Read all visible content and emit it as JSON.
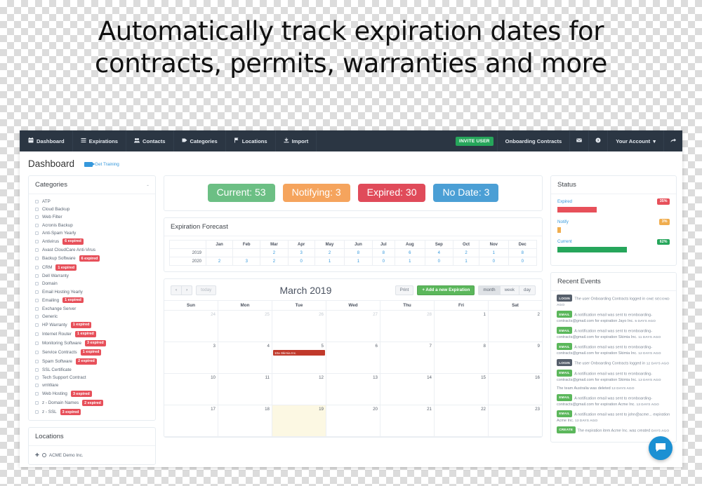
{
  "headline": "Automatically track expiration dates for contracts, permits, warranties and more",
  "navbar": {
    "left_items": [
      {
        "label": "Dashboard",
        "icon": "calendar-icon"
      },
      {
        "label": "Expirations",
        "icon": "list-icon"
      },
      {
        "label": "Contacts",
        "icon": "contacts-icon"
      },
      {
        "label": "Categories",
        "icon": "tag-icon"
      },
      {
        "label": "Locations",
        "icon": "flag-icon"
      },
      {
        "label": "Import",
        "icon": "import-icon"
      }
    ],
    "invite_label": "INVITE USER",
    "account_name": "Onboarding Contracts",
    "mail_icon": "envelope-icon",
    "help_icon": "question-circle-icon",
    "your_account": "Your Account",
    "logout_icon": "logout-icon"
  },
  "page": {
    "title": "Dashboard",
    "get_training": "Get Training"
  },
  "categories": {
    "title": "Categories",
    "collapse": "-",
    "items": [
      {
        "label": "ATP",
        "badge": ""
      },
      {
        "label": "Cloud Backup",
        "badge": ""
      },
      {
        "label": "Web Filter",
        "badge": ""
      },
      {
        "label": "Acronis Backup",
        "badge": ""
      },
      {
        "label": "Anti-Spam Yearly",
        "badge": ""
      },
      {
        "label": "Antivirus",
        "badge": "6 expired"
      },
      {
        "label": "Avast CloudCare Anti-Virus",
        "badge": ""
      },
      {
        "label": "Backup Software",
        "badge": "6 expired"
      },
      {
        "label": "CRM",
        "badge": "1 expired"
      },
      {
        "label": "Dell Warranty",
        "badge": ""
      },
      {
        "label": "Domain",
        "badge": ""
      },
      {
        "label": "Email Hosting Yearly",
        "badge": ""
      },
      {
        "label": "Emailing",
        "badge": "1 expired"
      },
      {
        "label": "Exchange Server",
        "badge": ""
      },
      {
        "label": "Generic",
        "badge": ""
      },
      {
        "label": "HP Warranty",
        "badge": "1 expired"
      },
      {
        "label": "Internet Router",
        "badge": "1 expired"
      },
      {
        "label": "Monitoring Software",
        "badge": "3 expired"
      },
      {
        "label": "Service Contracts",
        "badge": "1 expired"
      },
      {
        "label": "Spam Software",
        "badge": "2 expired"
      },
      {
        "label": "SSL Certificate",
        "badge": ""
      },
      {
        "label": "Tech Support Contract",
        "badge": ""
      },
      {
        "label": "vmWare",
        "badge": ""
      },
      {
        "label": "Web Hosting",
        "badge": "3 expired"
      },
      {
        "label": "z - Domain Names",
        "badge": "2 expired"
      },
      {
        "label": "z - SSL",
        "badge": "3 expired"
      }
    ]
  },
  "locations": {
    "title": "Locations",
    "items": [
      {
        "label": "ACME Demo Inc."
      }
    ]
  },
  "tiles": [
    {
      "label": "Current: 53",
      "color": "#6cbf84"
    },
    {
      "label": "Notifying: 3",
      "color": "#f5a45d"
    },
    {
      "label": "Expired: 30",
      "color": "#e04b5a"
    },
    {
      "label": "No Date: 3",
      "color": "#4b9fd5"
    }
  ],
  "forecast": {
    "title": "Expiration Forecast",
    "months": [
      "Jan",
      "Feb",
      "Mar",
      "Apr",
      "May",
      "Jun",
      "Jul",
      "Aug",
      "Sep",
      "Oct",
      "Nov",
      "Dec"
    ],
    "rows": [
      {
        "year": "2019",
        "values": [
          "",
          "",
          "2",
          "3",
          "2",
          "8",
          "8",
          "6",
          "4",
          "2",
          "1",
          "8"
        ]
      },
      {
        "year": "2020",
        "values": [
          "2",
          "3",
          "2",
          "0",
          "1",
          "1",
          "0",
          "1",
          "0",
          "1",
          "0",
          "0"
        ]
      }
    ]
  },
  "calendar": {
    "prev": "‹",
    "next": "›",
    "today_label": "today",
    "title": "March 2019",
    "print_label": "Print",
    "add_label": "+ Add a new Expiration",
    "views": [
      "month",
      "week",
      "day"
    ],
    "active_view": "month",
    "weekdays": [
      "Sun",
      "Mon",
      "Tue",
      "Wed",
      "Thu",
      "Fri",
      "Sat"
    ],
    "weeks": [
      [
        {
          "num": "24",
          "other": true
        },
        {
          "num": "25",
          "other": true
        },
        {
          "num": "26",
          "other": true
        },
        {
          "num": "27",
          "other": true
        },
        {
          "num": "28",
          "other": true
        },
        {
          "num": "1",
          "other": false
        },
        {
          "num": "2",
          "other": false
        }
      ],
      [
        {
          "num": "3",
          "other": false
        },
        {
          "num": "4",
          "other": false
        },
        {
          "num": "5",
          "other": false,
          "event": "10a Skimia Inc."
        },
        {
          "num": "6",
          "other": false
        },
        {
          "num": "7",
          "other": false
        },
        {
          "num": "8",
          "other": false
        },
        {
          "num": "9",
          "other": false
        }
      ],
      [
        {
          "num": "10",
          "other": false
        },
        {
          "num": "11",
          "other": false
        },
        {
          "num": "12",
          "other": false
        },
        {
          "num": "13",
          "other": false
        },
        {
          "num": "14",
          "other": false
        },
        {
          "num": "15",
          "other": false
        },
        {
          "num": "16",
          "other": false
        }
      ],
      [
        {
          "num": "17",
          "other": false
        },
        {
          "num": "18",
          "other": false
        },
        {
          "num": "19",
          "other": false,
          "today": true
        },
        {
          "num": "20",
          "other": false
        },
        {
          "num": "21",
          "other": false
        },
        {
          "num": "22",
          "other": false
        },
        {
          "num": "23",
          "other": false
        }
      ]
    ]
  },
  "status": {
    "title": "Status",
    "bars": [
      {
        "label": "Expired",
        "pct": "35%",
        "width": 35,
        "color": "#e7505a"
      },
      {
        "label": "Notify",
        "pct": "3%",
        "width": 3,
        "color": "#f0ad4e"
      },
      {
        "label": "Current",
        "pct": "62%",
        "width": 62,
        "color": "#26a65b"
      }
    ]
  },
  "recent_events": {
    "title": "Recent Events",
    "items": [
      {
        "tag": "LOGIN",
        "tag_class": "login",
        "text": "The user Onboarding Contracts logged in",
        "time": "ONE SECOND AGO"
      },
      {
        "tag": "EMAIL",
        "tag_class": "email",
        "text": "A notification email was sent to eronboarding-contracts@gmail.com for expiration Jayo Inc.",
        "time": "5 DAYS AGO"
      },
      {
        "tag": "EMAIL",
        "tag_class": "email",
        "text": "A notification email was sent to eronboarding-contracts@gmail.com for expiration Skimia Inc.",
        "time": "11 DAYS AGO"
      },
      {
        "tag": "EMAIL",
        "tag_class": "email",
        "text": "A notification email was sent to eronboarding-contracts@gmail.com for expiration Skimia Inc.",
        "time": "12 DAYS AGO"
      },
      {
        "tag": "LOGIN",
        "tag_class": "login",
        "text": "The user Onboarding Contracts logged in",
        "time": "12 DAYS AGO"
      },
      {
        "tag": "EMAIL",
        "tag_class": "email",
        "text": "A notification email was sent to eronboarding-contracts@gmail.com for expiration Skimia Inc.",
        "time": "13 DAYS AGO"
      },
      {
        "tag": "",
        "tag_class": "",
        "text": "The team Australia was deleted",
        "time": "13 DAYS AGO"
      },
      {
        "tag": "EMAIL",
        "tag_class": "email",
        "text": "A notification email was sent to eronboarding-contracts@gmail.com for expiration Acme Inc.",
        "time": "13 DAYS AGO"
      },
      {
        "tag": "EMAIL",
        "tag_class": "email",
        "text": "A notification email was sent to john@acme... expiration Acme Inc.",
        "time": "13 DAYS AGO"
      },
      {
        "tag": "CREATE",
        "tag_class": "create",
        "text": "The expiration item Acme Inc. was created",
        "time": "DAYS AGO"
      }
    ]
  },
  "chat": {
    "icon": "chat-bubble-icon"
  }
}
